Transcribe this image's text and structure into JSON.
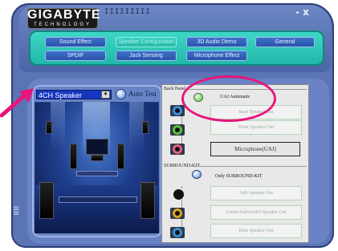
{
  "app": {
    "logo_text": "GIGABYTE",
    "logo_subtext": "TECHNOLOGY",
    "grip_marks": "IIIIIIIII",
    "window_controls": "- x"
  },
  "tabs": [
    {
      "label": "Sound Effect",
      "active": false
    },
    {
      "label": "Speaker Configuration",
      "active": true
    },
    {
      "label": "3D Audio Demo",
      "active": false
    },
    {
      "label": "General",
      "active": false
    },
    {
      "label": "SPDIF",
      "active": false
    },
    {
      "label": "Jack Sensing",
      "active": false
    },
    {
      "label": "Microphone Effect",
      "active": false
    }
  ],
  "speaker_select": {
    "value": "4CH Speaker"
  },
  "auto_test": {
    "label": "Auto Test"
  },
  "back_panel": {
    "label": "Back Panel",
    "uaj_label": "UAJ Automatic",
    "outputs": [
      {
        "label": "Rear Speaker Out",
        "selected": false,
        "jack_color": "#3a8fd8"
      },
      {
        "label": "Front Speaker Out",
        "selected": false,
        "jack_color": "#59c23c"
      },
      {
        "label": "Microphone(UAJ)",
        "selected": true,
        "jack_color": "#e0608a"
      }
    ]
  },
  "surround_kit": {
    "label": "SURROUND-KIT",
    "only_label": "Only SURROUND-KIT",
    "outputs": [
      {
        "label": "Side Speaker Out",
        "jack_color": "#1a1a1a"
      },
      {
        "label": "Center/Subwoofer Speaker Out",
        "jack_color": "#e0a020"
      },
      {
        "label": "Rear Speaker Out",
        "jack_color": "#3a8fd8"
      }
    ]
  },
  "colors": {
    "annotation": "#e8157b",
    "tab_panel": "#2fc4b6"
  }
}
